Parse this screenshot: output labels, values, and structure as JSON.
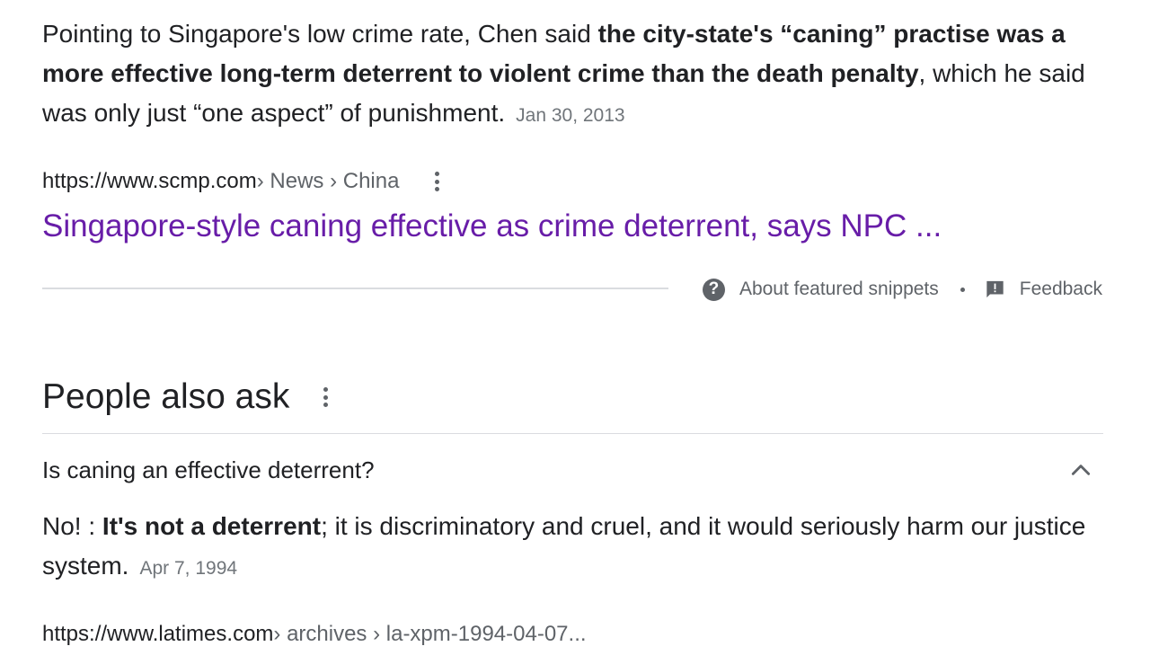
{
  "snippet": {
    "text_before": "Pointing to Singapore's low crime rate, Chen said ",
    "text_bold": "the city-state's “caning” practise was a more effective long-term deterrent to violent crime than the death penalty",
    "text_after": ", which he said was only just “one aspect” of punishment.",
    "date": "Jan 30, 2013"
  },
  "source": {
    "domain": "https://www.scmp.com",
    "breadcrumbs": " › News › China",
    "more_icon": "vertical-dots-icon"
  },
  "result": {
    "title": "Singapore-style caning effective as crime deterrent, says NPC ..."
  },
  "snippet_footer": {
    "about_label": "About featured snippets",
    "about_icon": "help-icon",
    "feedback_label": "Feedback",
    "feedback_icon": "feedback-icon"
  },
  "people_also_ask": {
    "heading": "People also ask",
    "questions": [
      {
        "question": "Is caning an effective deterrent?",
        "expanded": true,
        "answer_prefix": "No! : ",
        "answer_bold": "It's not a deterrent",
        "answer_after": "; it is discriminatory and cruel, and it would seriously harm our justice system.",
        "date": "Apr 7, 1994",
        "source_domain": "https://www.latimes.com",
        "source_breadcrumbs": " › archives › la-xpm-1994-04-07..."
      }
    ]
  },
  "colors": {
    "link_visited": "#681da8",
    "text": "#202124",
    "secondary": "#5f6368",
    "divider": "#dadce0"
  }
}
